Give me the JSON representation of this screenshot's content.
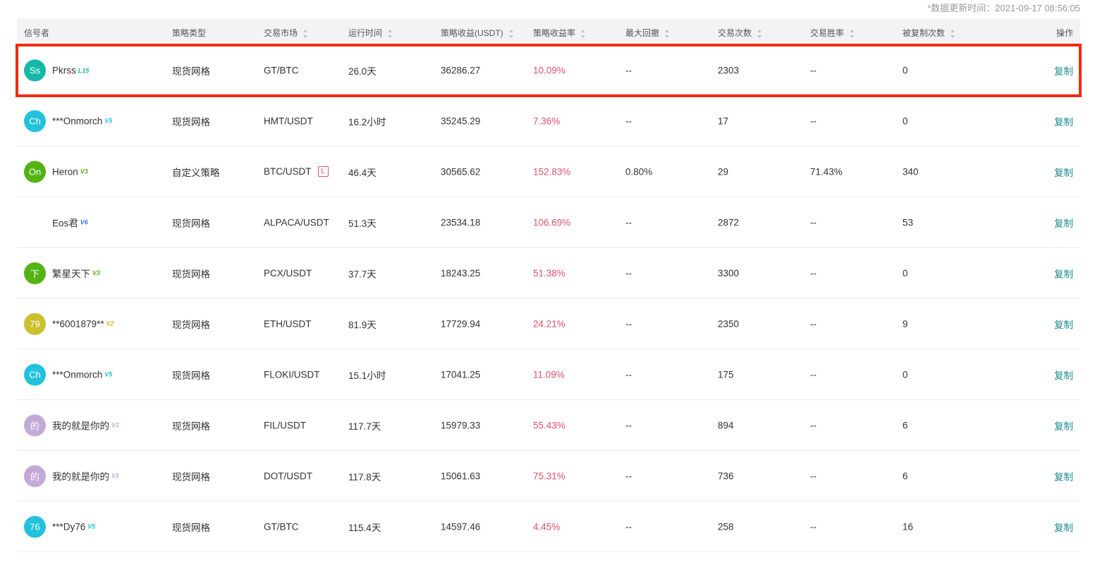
{
  "update_time": "*数据更新时间：2021-09-17 08:56:05",
  "headers": [
    "信号者",
    "策略类型",
    "交易市场",
    "运行时间",
    "策略收益(USDT)",
    "策略收益率",
    "最大回撤",
    "交易次数",
    "交易胜率",
    "被复制次数",
    "操作"
  ],
  "rows": [
    {
      "avatar": "Ss",
      "avatar_color": "#14b8a6",
      "name": "Pkrss",
      "level": "L15",
      "level_color": "#14b8a6",
      "type": "现货网格",
      "market": "GT/BTC",
      "tag": "",
      "runtime": "26.0天",
      "profit": "36286.27",
      "rate": "10.09%",
      "drawdown": "--",
      "trades": "2303",
      "winrate": "--",
      "copied": "0",
      "action": "复制"
    },
    {
      "avatar": "Ch",
      "avatar_color": "#22c1dc",
      "name": "***Onmorch",
      "level": "V5",
      "level_color": "#22c1dc",
      "type": "现货网格",
      "market": "HMT/USDT",
      "tag": "",
      "runtime": "16.2小时",
      "profit": "35245.29",
      "rate": "7.36%",
      "drawdown": "--",
      "trades": "17",
      "winrate": "--",
      "copied": "0",
      "action": "复制"
    },
    {
      "avatar": "On",
      "avatar_color": "#52b313",
      "name": "Heron",
      "level": "V3",
      "level_color": "#52b313",
      "type": "自定义策略",
      "market": "BTC/USDT",
      "tag": "L",
      "runtime": "46.4天",
      "profit": "30565.62",
      "rate": "152.83%",
      "drawdown": "0.80%",
      "trades": "29",
      "winrate": "71.43%",
      "copied": "340",
      "action": "复制"
    },
    {
      "avatar": "",
      "avatar_color": "",
      "name": "Eos君",
      "level": "V6",
      "level_color": "#3b7dd8",
      "type": "现货网格",
      "market": "ALPACA/USDT",
      "tag": "",
      "runtime": "51.3天",
      "profit": "23534.18",
      "rate": "106.69%",
      "drawdown": "--",
      "trades": "2872",
      "winrate": "--",
      "copied": "53",
      "action": "复制"
    },
    {
      "avatar": "下",
      "avatar_color": "#52b313",
      "name": "繁星天下",
      "level": "V3",
      "level_color": "#52b313",
      "type": "现货网格",
      "market": "PCX/USDT",
      "tag": "",
      "runtime": "37.7天",
      "profit": "18243.25",
      "rate": "51.38%",
      "drawdown": "--",
      "trades": "3300",
      "winrate": "--",
      "copied": "0",
      "action": "复制"
    },
    {
      "avatar": "79",
      "avatar_color": "#c9c12d",
      "name": "**6001879**",
      "level": "V2",
      "level_color": "#c9c12d",
      "type": "现货网格",
      "market": "ETH/USDT",
      "tag": "",
      "runtime": "81.9天",
      "profit": "17729.94",
      "rate": "24.21%",
      "drawdown": "--",
      "trades": "2350",
      "winrate": "--",
      "copied": "9",
      "action": "复制"
    },
    {
      "avatar": "Ch",
      "avatar_color": "#22c1dc",
      "name": "***Onmorch",
      "level": "V5",
      "level_color": "#22c1dc",
      "type": "现货网格",
      "market": "FLOKI/USDT",
      "tag": "",
      "runtime": "15.1小时",
      "profit": "17041.25",
      "rate": "11.09%",
      "drawdown": "--",
      "trades": "175",
      "winrate": "--",
      "copied": "0",
      "action": "复制"
    },
    {
      "avatar": "的",
      "avatar_color": "#c3a9d6",
      "name": "我的就是你的",
      "level": "V1",
      "level_color": "#c3a9d6",
      "type": "现货网格",
      "market": "FIL/USDT",
      "tag": "",
      "runtime": "117.7天",
      "profit": "15979.33",
      "rate": "55.43%",
      "drawdown": "--",
      "trades": "894",
      "winrate": "--",
      "copied": "6",
      "action": "复制"
    },
    {
      "avatar": "的",
      "avatar_color": "#c3a9d6",
      "name": "我的就是你的",
      "level": "V1",
      "level_color": "#c3a9d6",
      "type": "现货网格",
      "market": "DOT/USDT",
      "tag": "",
      "runtime": "117.8天",
      "profit": "15061.63",
      "rate": "75.31%",
      "drawdown": "--",
      "trades": "736",
      "winrate": "--",
      "copied": "6",
      "action": "复制"
    },
    {
      "avatar": "76",
      "avatar_color": "#22c1dc",
      "name": "***Dy76",
      "level": "V5",
      "level_color": "#22c1dc",
      "type": "现货网格",
      "market": "GT/BTC",
      "tag": "",
      "runtime": "115.4天",
      "profit": "14597.46",
      "rate": "4.45%",
      "drawdown": "--",
      "trades": "258",
      "winrate": "--",
      "copied": "16",
      "action": "复制"
    }
  ]
}
